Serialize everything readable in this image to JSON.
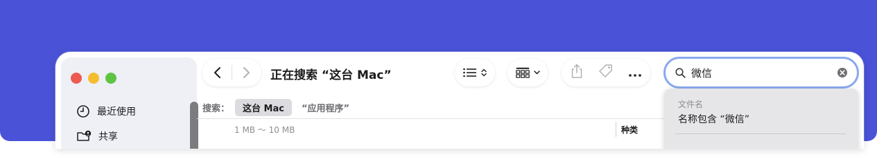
{
  "window": {
    "title": "正在搜索 “这台 Mac”"
  },
  "sidebar": {
    "items": [
      {
        "label": "最近使用",
        "icon": "clock-icon"
      },
      {
        "label": "共享",
        "icon": "shared-folder-icon"
      }
    ]
  },
  "toolbar": {
    "back_icon": "chevron-left-icon",
    "forward_icon": "chevron-right-icon",
    "list_view_icon": "list-view-icon",
    "group_icon": "gallery-group-icon",
    "share_icon": "share-icon",
    "tag_icon": "tag-icon",
    "more_icon": "ellipsis-icon"
  },
  "search": {
    "value": "微信",
    "icon": "magnifier-icon"
  },
  "scope": {
    "label": "搜索：",
    "active": "这台 Mac",
    "other": "“应用程序”"
  },
  "columns": {
    "size_filter": "1 MB ～ 10 MB",
    "kind": "种类"
  },
  "suggestions": {
    "section": "文件名",
    "item": "名称包含 “微信”"
  },
  "colors": {
    "desktop": "#4a52d8",
    "search_focus": "#8aa8f0",
    "traffic_red": "#ee5a52",
    "traffic_yellow": "#f5bd2e",
    "traffic_green": "#5fc343"
  }
}
